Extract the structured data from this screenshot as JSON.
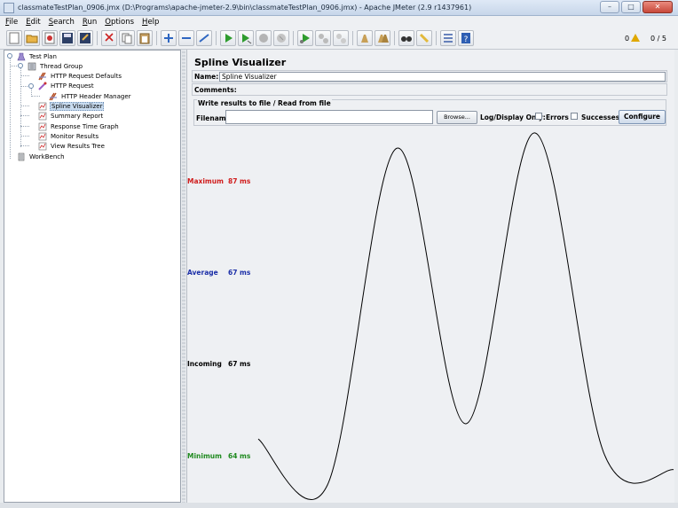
{
  "window": {
    "title": "classmateTestPlan_0906.jmx (D:\\Programs\\apache-jmeter-2.9\\bin\\classmateTestPlan_0906.jmx) - Apache JMeter (2.9 r1437961)",
    "minimize": "–",
    "maximize": "□",
    "close": "✕"
  },
  "menu": [
    "File",
    "Edit",
    "Search",
    "Run",
    "Options",
    "Help"
  ],
  "toolbar": {
    "icons": [
      "new-icon",
      "open-icon",
      "close-icon",
      "save-icon",
      "save-as-icon",
      "cut-icon",
      "copy-icon",
      "paste-icon",
      "expand-icon",
      "collapse-icon",
      "toggle-icon",
      "start-icon",
      "start-no-timers-icon",
      "stop-icon",
      "shutdown-icon",
      "remote-start-icon",
      "remote-stop-icon",
      "remote-shutdown-icon",
      "clear-icon",
      "clear-all-icon",
      "search-icon",
      "reset-search-icon",
      "function-helper-icon",
      "help-icon"
    ],
    "warning_count": "0",
    "threads": "0 / 5"
  },
  "tree": {
    "nodes": [
      {
        "label": "Test Plan",
        "icon": "test-plan-icon"
      },
      {
        "label": "Thread Group",
        "icon": "thread-group-icon"
      },
      {
        "label": "HTTP Request Defaults",
        "icon": "config-icon"
      },
      {
        "label": "HTTP Request",
        "icon": "sampler-icon"
      },
      {
        "label": "HTTP Header Manager",
        "icon": "config-icon"
      },
      {
        "label": "Spline Visualizer",
        "icon": "listener-icon",
        "selected": true
      },
      {
        "label": "Summary Report",
        "icon": "listener-icon"
      },
      {
        "label": "Response Time Graph",
        "icon": "listener-icon"
      },
      {
        "label": "Monitor Results",
        "icon": "listener-icon"
      },
      {
        "label": "View Results Tree",
        "icon": "listener-icon"
      },
      {
        "label": "WorkBench",
        "icon": "workbench-icon"
      }
    ]
  },
  "panel": {
    "title": "Spline Visualizer",
    "name_label": "Name:",
    "name_value": "Spline Visualizer",
    "comments_label": "Comments:",
    "file_group_label": "Write results to file / Read from file",
    "filename_label": "Filename",
    "filename_value": "",
    "browse_label": "Browse...",
    "log_display_label": "Log/Display Only:",
    "errors_label": "Errors",
    "successes_label": "Successes",
    "configure_label": "Configure"
  },
  "stats": {
    "maximum": {
      "label": "Maximum",
      "value": "87 ms",
      "color": "#d01c1c"
    },
    "average": {
      "label": "Average",
      "value": "67 ms",
      "color": "#1c2fa8"
    },
    "incoming": {
      "label": "Incoming",
      "value": "67 ms",
      "color": "#000000"
    },
    "minimum": {
      "label": "Minimum",
      "value": "64 ms",
      "color": "#1f8a1f"
    }
  },
  "chart_data": {
    "type": "line",
    "x": [
      0,
      1,
      2,
      3,
      4,
      5,
      6
    ],
    "values": [
      67,
      64,
      86,
      68,
      87,
      66,
      65
    ],
    "ylim": [
      64,
      87
    ]
  }
}
